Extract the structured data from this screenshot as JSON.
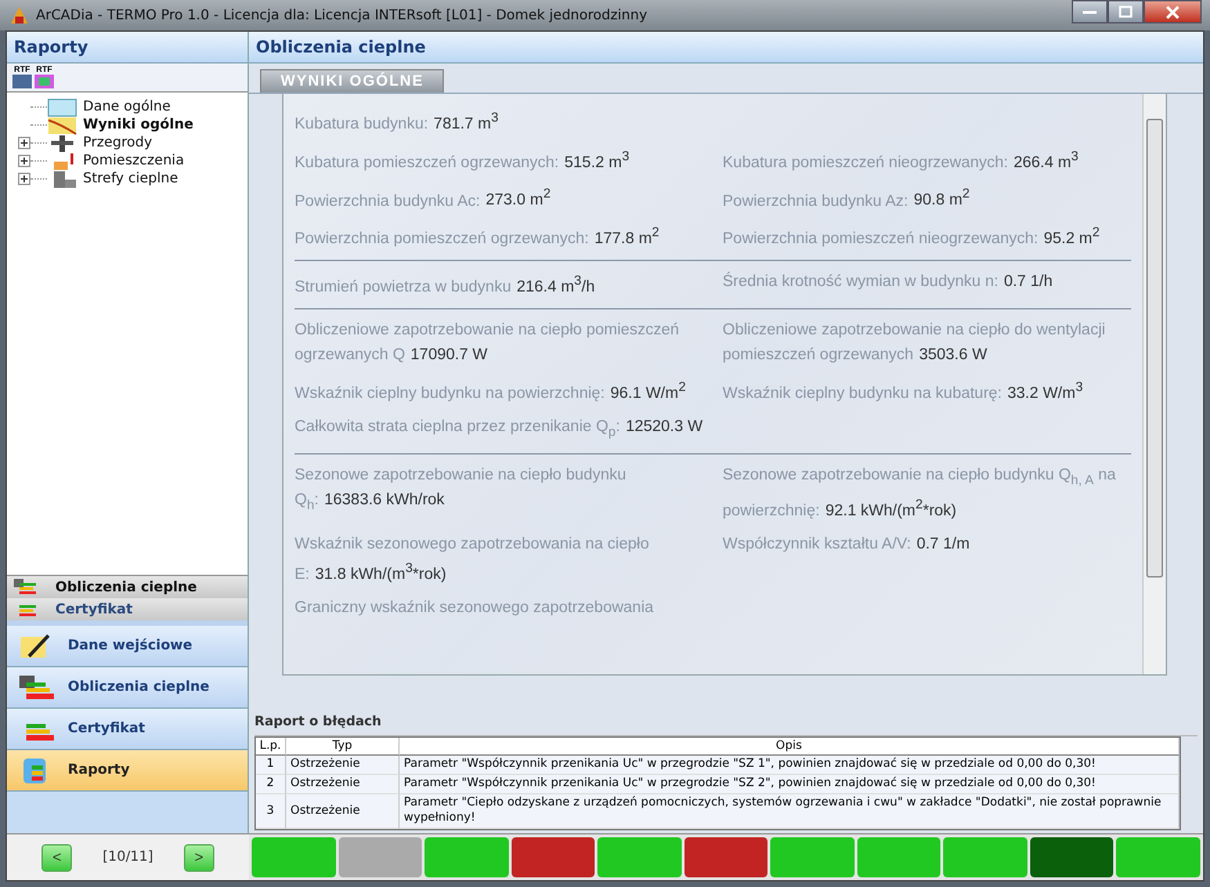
{
  "window": {
    "title": "ArCADia - TERMO Pro 1.0 - Licencja dla: Licencja INTERsoft [L01] - Domek jednorodzinny"
  },
  "sidebar": {
    "title": "Raporty",
    "toolbar": [
      "RTF",
      "RTF"
    ],
    "tree": [
      {
        "label": "Dane ogólne",
        "kind": "leaf",
        "selected": false
      },
      {
        "label": "Wyniki ogólne",
        "kind": "leaf",
        "selected": true
      },
      {
        "label": "Przegrody",
        "kind": "branch",
        "selected": false,
        "expanded": false
      },
      {
        "label": "Pomieszczenia",
        "kind": "branch",
        "selected": false,
        "expanded": false
      },
      {
        "label": "Strefy cieplne",
        "kind": "branch",
        "selected": false,
        "expanded": false
      }
    ],
    "small_nav": [
      "Obliczenia cieplne",
      "Certyfikat"
    ],
    "nav": [
      {
        "label": "Dane wejściowe",
        "selected": false
      },
      {
        "label": "Obliczenia cieplne",
        "selected": false
      },
      {
        "label": "Certyfikat",
        "selected": false
      },
      {
        "label": "Raporty",
        "selected": true
      }
    ],
    "pager": {
      "prev": "<",
      "text": "[10/11]",
      "next": ">"
    }
  },
  "main": {
    "title": "Obliczenia cieplne",
    "tab": "WYNIKI OGÓLNE",
    "sections": [
      {
        "rows": [
          [
            {
              "label": "Kubatura budynku:",
              "value": "781.7 m$^{3}$"
            }
          ],
          [
            {
              "label": "Kubatura pomieszczeń ogrzewanych:",
              "value": "515.2 m$^{3}$"
            },
            {
              "label": "Kubatura pomieszczeń nieogrzewanych:",
              "value": "266.4 m$^{3}$"
            }
          ],
          [
            {
              "label": "Powierzchnia budynku Ac:",
              "value": "273.0 m$^{2}$"
            },
            {
              "label": "Powierzchnia budynku Az:",
              "value": "90.8 m$^{2}$"
            }
          ],
          [
            {
              "label": "Powierzchnia pomieszczeń ogrzewanych:",
              "value": "177.8 m$^{2}$"
            },
            {
              "label": "Powierzchnia pomieszczeń nieogrzewanych:",
              "value": "95.2 m$^{2}$"
            }
          ]
        ]
      },
      {
        "rows": [
          [
            {
              "label": "Strumień powietrza w budynku",
              "value": "216.4 m$^{3}$/h"
            },
            {
              "label": "Średnia krotność wymian w budynku n:",
              "value": "0.7 1/h"
            }
          ]
        ]
      },
      {
        "rows": [
          [
            {
              "label": "Obliczeniowe zapotrzebowanie na ciepło pomieszczeń ogrzewanych Q",
              "value": "17090.7 W"
            },
            {
              "label": "Obliczeniowe zapotrzebowanie na ciepło do wentylacji pomieszczeń ogrzewanych",
              "value": "3503.6 W"
            }
          ],
          [
            {
              "label": "Wskaźnik cieplny budynku na powierzchnię:",
              "value": "96.1 W/m$^{2}$"
            },
            {
              "label": "Wskaźnik cieplny budynku na kubaturę:",
              "value": "33.2 W/m$^{3}$"
            }
          ],
          [
            {
              "label": "Całkowita strata cieplna przez przenikanie Q$_{p}$:",
              "value": "12520.3 W"
            }
          ]
        ]
      },
      {
        "rows": [
          [
            {
              "label": "Sezonowe zapotrzebowanie na ciepło budynku Q$_{h}$:",
              "value": "16383.6 kWh/rok"
            },
            {
              "label": "Sezonowe zapotrzebowanie na ciepło budynku Q$_{h, A}$ na powierzchnię:",
              "value": "92.1 kWh/(m$^{2}$*rok)"
            }
          ],
          [
            {
              "label": "Wskaźnik sezonowego zapotrzebowania na ciepło E:",
              "value": "31.8 kWh/(m$^{3}$*rok)"
            },
            {
              "label": "Współczynnik kształtu A/V:",
              "value": "0.7 1/m"
            }
          ],
          [
            {
              "label": "Graniczny wskaźnik sezonowego zapotrzebowania"
            }
          ]
        ]
      }
    ]
  },
  "errors": {
    "title": "Raport o błędach",
    "columns": [
      "L.p.",
      "Typ",
      "Opis"
    ],
    "rows": [
      [
        "1",
        "Ostrzeżenie",
        "Parametr \"Współczynnik przenikania Uc\" w przegrodzie \"SZ 1\", powinien znajdować się w przedziale od 0,00 do 0,30!"
      ],
      [
        "2",
        "Ostrzeżenie",
        "Parametr \"Współczynnik przenikania Uc\" w przegrodzie \"SZ 2\", powinien znajdować się w przedziale od 0,00 do 0,30!"
      ],
      [
        "3",
        "Ostrzeżenie",
        "Parametr \"Ciepło odzyskane z urządzeń pomocniczych, systemów ogrzewania i cwu\" w zakładce \"Dodatki\", nie został poprawnie wypełniony!"
      ]
    ]
  },
  "status_bar": [
    {
      "color": "#22c822"
    },
    {
      "color": "#aaaaaa"
    },
    {
      "color": "#22c822"
    },
    {
      "color": "#c22424"
    },
    {
      "color": "#22c822"
    },
    {
      "color": "#c22424"
    },
    {
      "color": "#22c822"
    },
    {
      "color": "#22c822"
    },
    {
      "color": "#22c822"
    },
    {
      "color": "#0b600b"
    },
    {
      "color": "#22c822"
    }
  ]
}
